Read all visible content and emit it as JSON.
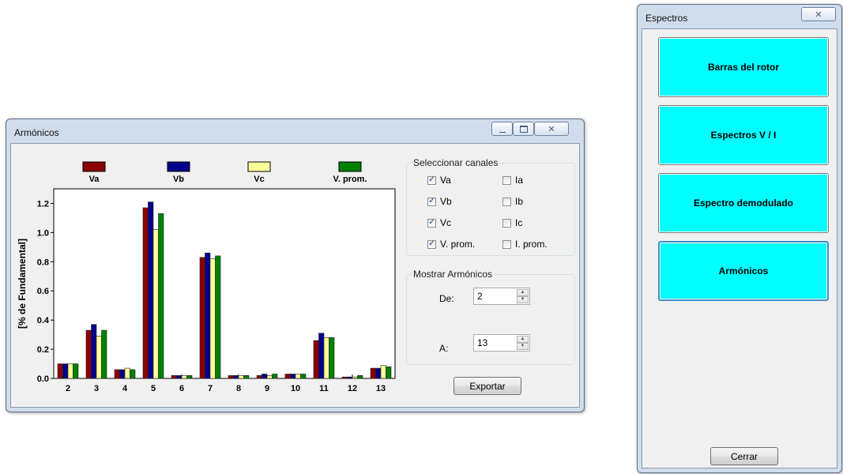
{
  "armonicos_window": {
    "title": "Armónicos",
    "channels_group": {
      "label": "Seleccionar canales",
      "items": [
        {
          "label": "Va",
          "checked": true
        },
        {
          "label": "Ia",
          "checked": false
        },
        {
          "label": "Vb",
          "checked": true
        },
        {
          "label": "Ib",
          "checked": false
        },
        {
          "label": "Vc",
          "checked": true
        },
        {
          "label": "Ic",
          "checked": false
        },
        {
          "label": "V. prom.",
          "checked": true
        },
        {
          "label": "I. prom.",
          "checked": false
        }
      ]
    },
    "harmonics_group": {
      "label": "Mostrar Armónicos",
      "from_label": "De:",
      "from_value": "2",
      "to_label": "A:",
      "to_value": "13"
    },
    "export_button": "Exportar"
  },
  "espectros_window": {
    "title": "Espectros",
    "buttons": [
      "Barras del rotor",
      "Espectros V / I",
      "Espectro demodulado",
      "Armónicos"
    ],
    "close_button": "Cerrar"
  },
  "chart_data": {
    "type": "bar",
    "ylabel": "[% de Fundamental]",
    "ylim": [
      0,
      1.3
    ],
    "yticks": [
      "0.0",
      "0.2",
      "0.4",
      "0.6",
      "0.8",
      "1.0",
      "1.2"
    ],
    "categories": [
      "2",
      "3",
      "4",
      "5",
      "6",
      "7",
      "8",
      "9",
      "10",
      "11",
      "12",
      "13"
    ],
    "legend_position": "top",
    "series": [
      {
        "name": "Va",
        "color": "#8b0000",
        "values": [
          0.1,
          0.33,
          0.06,
          1.17,
          0.02,
          0.83,
          0.02,
          0.02,
          0.03,
          0.26,
          0.01,
          0.07
        ]
      },
      {
        "name": "Vb",
        "color": "#00008b",
        "values": [
          0.1,
          0.37,
          0.06,
          1.21,
          0.02,
          0.86,
          0.02,
          0.03,
          0.03,
          0.31,
          0.01,
          0.07
        ]
      },
      {
        "name": "Vc",
        "color": "#ffff99",
        "values": [
          0.1,
          0.29,
          0.07,
          1.02,
          0.02,
          0.82,
          0.02,
          0.02,
          0.03,
          0.28,
          0.01,
          0.09
        ]
      },
      {
        "name": "V. prom.",
        "color": "#008000",
        "values": [
          0.1,
          0.33,
          0.06,
          1.13,
          0.02,
          0.84,
          0.02,
          0.03,
          0.03,
          0.28,
          0.02,
          0.08
        ]
      }
    ]
  }
}
